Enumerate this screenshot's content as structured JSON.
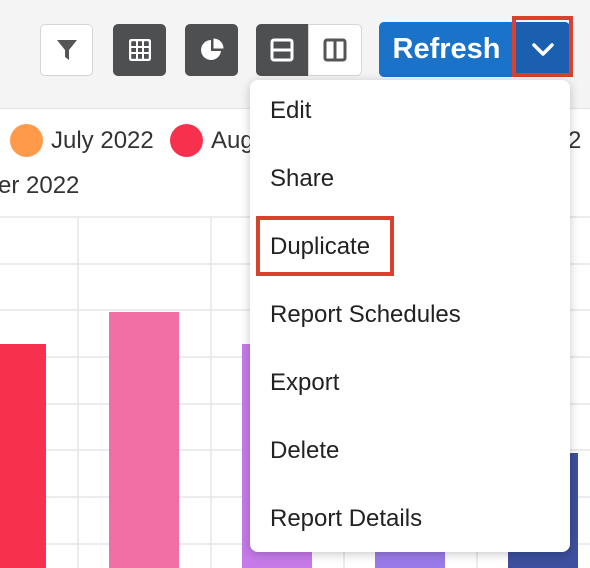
{
  "toolbar": {
    "filter_icon": "filter-icon",
    "table_icon": "table-grid-icon",
    "pie_icon": "pie-chart-icon",
    "split_h_icon": "split-horizontal-icon",
    "split_v_icon": "split-vertical-icon",
    "refresh_label": "Refresh",
    "dropdown_icon": "chevron-down-icon",
    "primary_color": "#1a73c8",
    "highlight_color": "#d9412a"
  },
  "legend": {
    "items": [
      {
        "label": "July 2022",
        "color": "#ff9a4a"
      },
      {
        "label": "Aug",
        "color": "#f7304e"
      }
    ],
    "partial_right": "2",
    "second_row": "er 2022"
  },
  "chart_data": {
    "type": "bar",
    "series": [
      {
        "name": "Aug",
        "color": "#f7304e",
        "value": 224
      },
      {
        "name": "",
        "color": "#f26fa6",
        "value": 256
      },
      {
        "name": "",
        "color": "#c57ae8",
        "value": 224
      },
      {
        "name": "",
        "color": "#9a7ae8",
        "value": 60
      },
      {
        "name": "",
        "color": "#3d4f9e",
        "value": 115
      }
    ]
  },
  "menu": {
    "items": [
      "Edit",
      "Share",
      "Duplicate",
      "Report Schedules",
      "Export",
      "Delete",
      "Report Details"
    ],
    "highlighted": "Duplicate"
  }
}
